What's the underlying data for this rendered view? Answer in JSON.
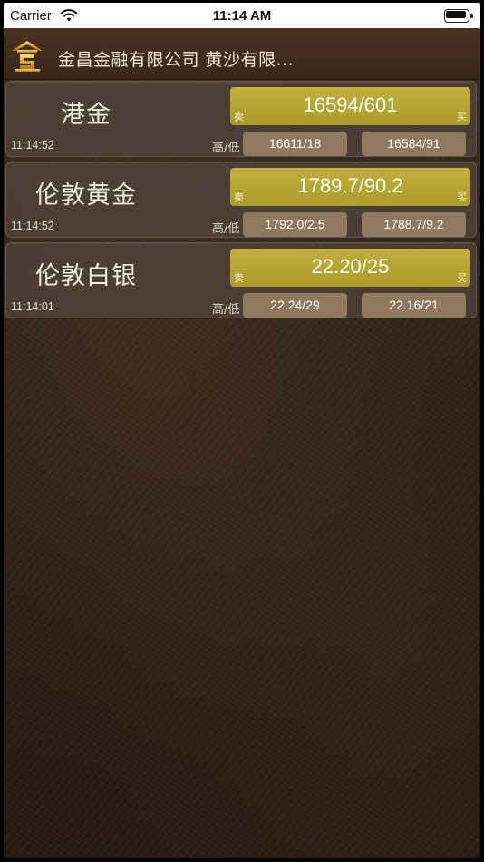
{
  "status_bar": {
    "carrier": "Carrier",
    "time": "11:14 AM",
    "icons": [
      "wifi-icon",
      "battery-icon"
    ]
  },
  "nav": {
    "logo_icon": "company-logo",
    "title": "金昌金融有限公司  黄沙有限..."
  },
  "labels": {
    "sell": "卖",
    "buy": "买",
    "high_low": "高/低"
  },
  "quotes": [
    {
      "name": "港金",
      "time": "11:14:52",
      "price": "16594/601",
      "high": "16611/18",
      "low": "16584/91"
    },
    {
      "name": "伦敦黄金",
      "time": "11:14:52",
      "price": "1789.7/90.2",
      "high": "1792.0/2.5",
      "low": "1788.7/9.2"
    },
    {
      "name": "伦敦白银",
      "time": "11:14:01",
      "price": "22.20/25",
      "high": "22.24/29",
      "low": "22.16/21"
    }
  ],
  "colors": {
    "price_box": "#b8a633",
    "hl_box": "#8f7a60",
    "nav_bg": "#3f2a1c"
  }
}
